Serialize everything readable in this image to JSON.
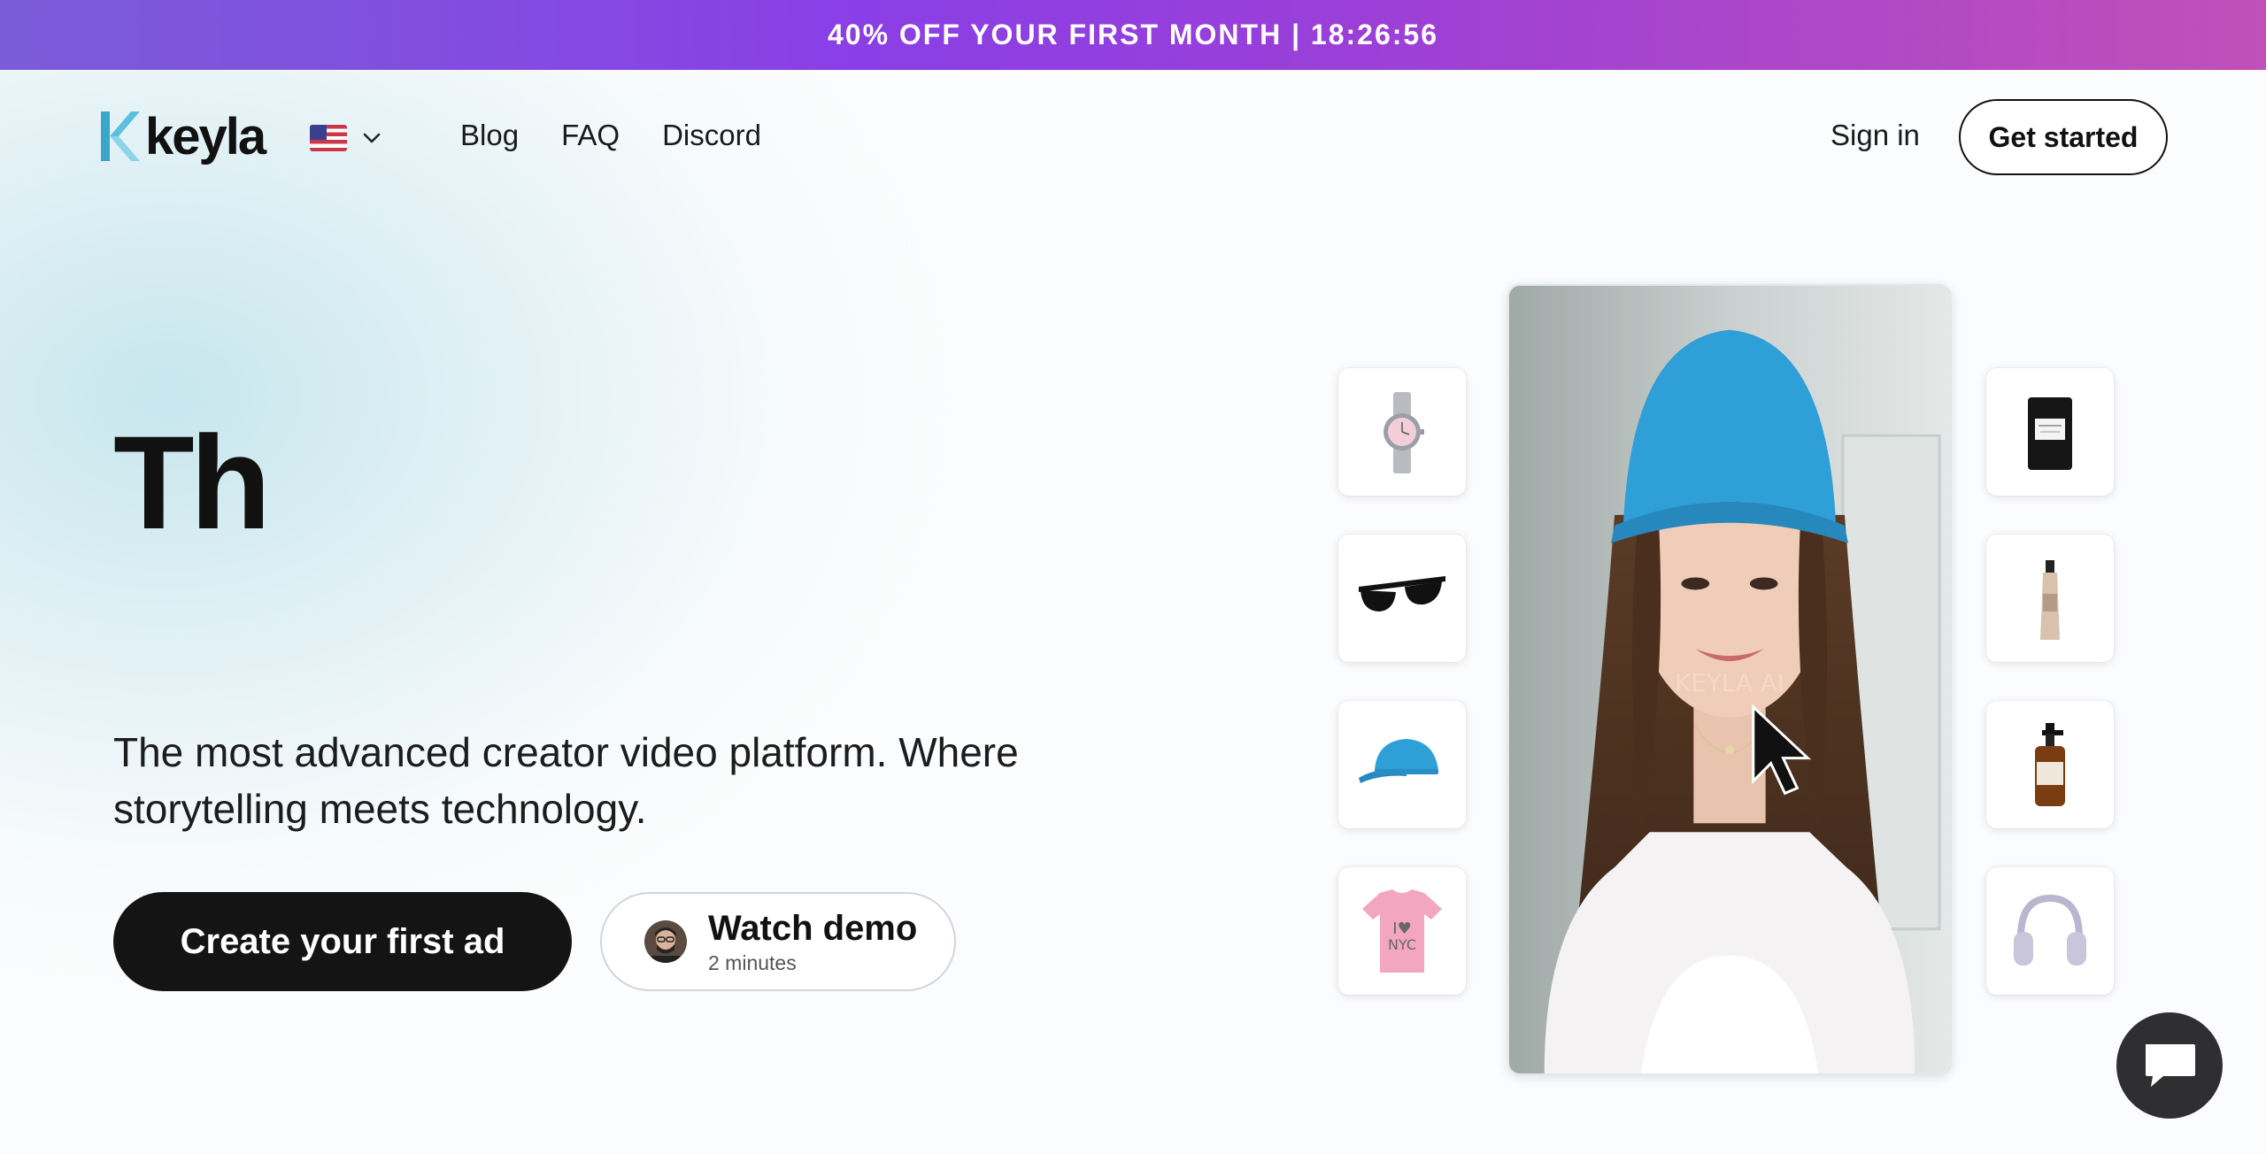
{
  "promo": {
    "text": "40% OFF YOUR FIRST MONTH | 18:26:56"
  },
  "header": {
    "logo_text": "keyla",
    "language": {
      "flag": "us-flag-icon"
    },
    "nav": [
      "Blog",
      "FAQ",
      "Discord"
    ],
    "sign_in": "Sign in",
    "get_started": "Get started"
  },
  "hero": {
    "title": "Th",
    "subtitle": "The most advanced creator video platform. Where storytelling meets technology.",
    "cta_primary": "Create your first ad",
    "cta_demo": {
      "title": "Watch demo",
      "subtitle": "2 minutes"
    }
  },
  "products": {
    "left": [
      "watch-icon",
      "sunglasses-icon",
      "cap-icon",
      "tshirt-icon"
    ],
    "right": [
      "candle-icon",
      "cream-tube-icon",
      "soap-bottle-icon",
      "headphones-icon"
    ]
  },
  "video": {
    "watermark": "KEYLA AI"
  },
  "colors": {
    "banner_start": "#7a5cd8",
    "banner_end": "#c150b8",
    "primary_button": "#141414",
    "logo_accent": "#5bc0de",
    "cap_blue": "#2f9fd8"
  }
}
